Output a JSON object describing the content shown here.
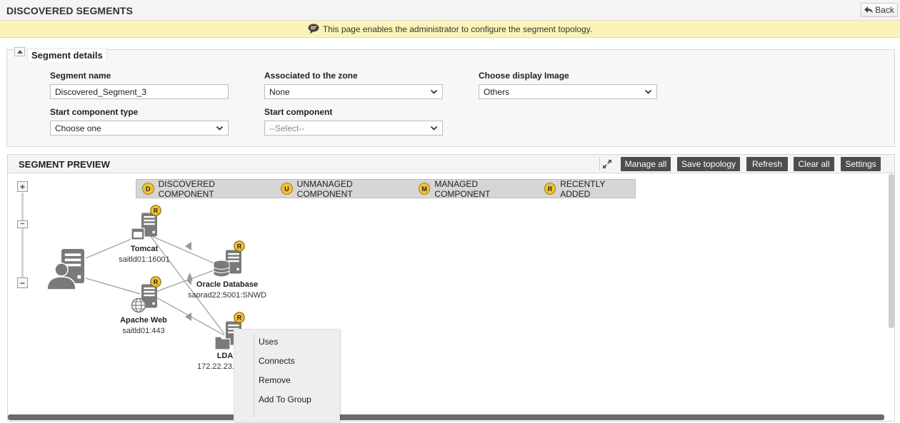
{
  "header": {
    "title": "DISCOVERED SEGMENTS",
    "back_label": "Back"
  },
  "banner": {
    "text": "This page enables the administrator to configure the segment topology."
  },
  "segment_details": {
    "title": "Segment details",
    "segment_name_label": "Segment name",
    "segment_name_value": "Discovered_Segment_3",
    "zone_label": "Associated to the zone",
    "zone_value": "None",
    "display_image_label": "Choose display Image",
    "display_image_value": "Others",
    "start_type_label": "Start component type",
    "start_type_value": "Choose one",
    "start_component_label": "Start component",
    "start_component_value": "--Select--"
  },
  "preview": {
    "title": "SEGMENT PREVIEW",
    "buttons": {
      "manage_all": "Manage all",
      "save_topology": "Save topology",
      "refresh": "Refresh",
      "clear_all": "Clear all",
      "settings": "Settings"
    },
    "legend": [
      {
        "badge": "D",
        "label": "DISCOVERED COMPONENT"
      },
      {
        "badge": "U",
        "label": "UNMANAGED COMPONENT"
      },
      {
        "badge": "M",
        "label": "MANAGED COMPONENT"
      },
      {
        "badge": "R",
        "label": "RECENTLY ADDED"
      }
    ],
    "zoom": {
      "in_label": "+",
      "out_label": "−",
      "thumb_label": "−"
    },
    "nodes": {
      "tomcat": {
        "name": "Tomcat",
        "address": "saitld01:16001",
        "badge": "R"
      },
      "oracle": {
        "name": "Oracle Database",
        "address": "saorad22:5001:SNWD",
        "badge": "R"
      },
      "apache": {
        "name": "Apache Web",
        "address": "saitld01:443",
        "badge": "R"
      },
      "ldap": {
        "name": "LDA",
        "address": "172.22.23.",
        "badge": "R"
      }
    },
    "context_menu": [
      "Uses",
      "Connects",
      "Remove",
      "Add To Group"
    ]
  },
  "colors": {
    "badge": "#f1c232",
    "button_bg": "#4d4d4d",
    "banner_bg": "#fcf3b8",
    "icon_gray": "#7a7a7a"
  }
}
